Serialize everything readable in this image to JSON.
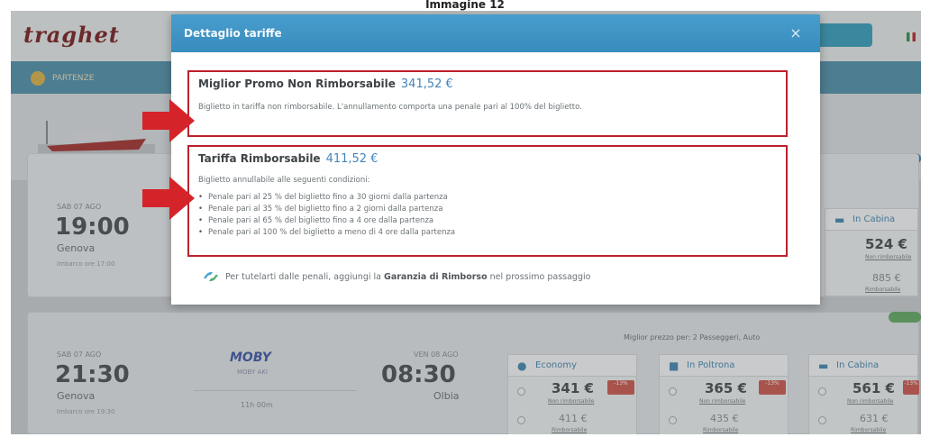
{
  "caption": "Immagine 12",
  "site": {
    "logo": "traghet",
    "header_button": "",
    "nav_item": "PARTENZE"
  },
  "trip1": {
    "date": "SAB 07 AGO",
    "time": "19:00",
    "port": "Genova",
    "note": "Imbarco ore 17:00",
    "fares": [
      {
        "name": "In Cabina",
        "price": "524 €",
        "link": "Non rimborsabile",
        "alt_price": "885 €",
        "alt_link": "Rimborsabile"
      }
    ]
  },
  "trip2": {
    "date": "SAB 07 AGO",
    "time": "21:30",
    "port": "Genova",
    "note": "Imbarco ore 19:30",
    "operator": "MOBY",
    "operator_sub": "MOBY AKI",
    "duration": "11h 00m",
    "arr_date": "VEN 08 AGO",
    "arr_time": "08:30",
    "arr_port": "Olbia",
    "best_note": "Miglior prezzo per: 2 Passeggeri, Auto",
    "fares": [
      {
        "name": "Economy",
        "price": "341 €",
        "tag": "-13%",
        "link": "Non rimborsabile",
        "alt_price": "411 €",
        "alt_link": "Rimborsabile"
      },
      {
        "name": "In Poltrona",
        "price": "365 €",
        "tag": "-13%",
        "link": "Non rimborsabile",
        "alt_price": "435 €",
        "alt_link": "Rimborsabile"
      },
      {
        "name": "In Cabina",
        "price": "561 €",
        "tag": "-13%",
        "link": "Non rimborsabile",
        "alt_price": "631 €",
        "alt_link": "Rimborsabile"
      }
    ]
  },
  "modal": {
    "title": "Dettaglio tariffe",
    "close": "×",
    "promo": {
      "title": "Miglior Promo Non Rimborsabile",
      "price": "341,52 €",
      "text": "Biglietto in tariffa non rimborsabile. L'annullamento comporta una penale pari al 100% del biglietto."
    },
    "refundable": {
      "title": "Tariffa Rimborsabile",
      "price": "411,52 €",
      "intro": "Biglietto annullabile alle seguenti condizioni:",
      "conditions": [
        "Penale pari al 25 % del biglietto fino a 30 giorni dalla partenza",
        "Penale pari al 35 % del biglietto fino a 2 giorni dalla partenza",
        "Penale pari al 65 % del biglietto fino a 4 ore dalla partenza",
        "Penale pari al 100 % del biglietto a meno di 4 ore dalla partenza"
      ]
    },
    "footer": {
      "before": "Per tutelarti dalle penali, aggiungi la",
      "strong": "Garanzia di Rimborso",
      "after": "nel prossimo passaggio"
    }
  },
  "colors": {
    "accent": "#2b8fc8",
    "highlight_border": "#d11a2a",
    "arrow": "#ee1c24",
    "price": "#3a86c8"
  }
}
